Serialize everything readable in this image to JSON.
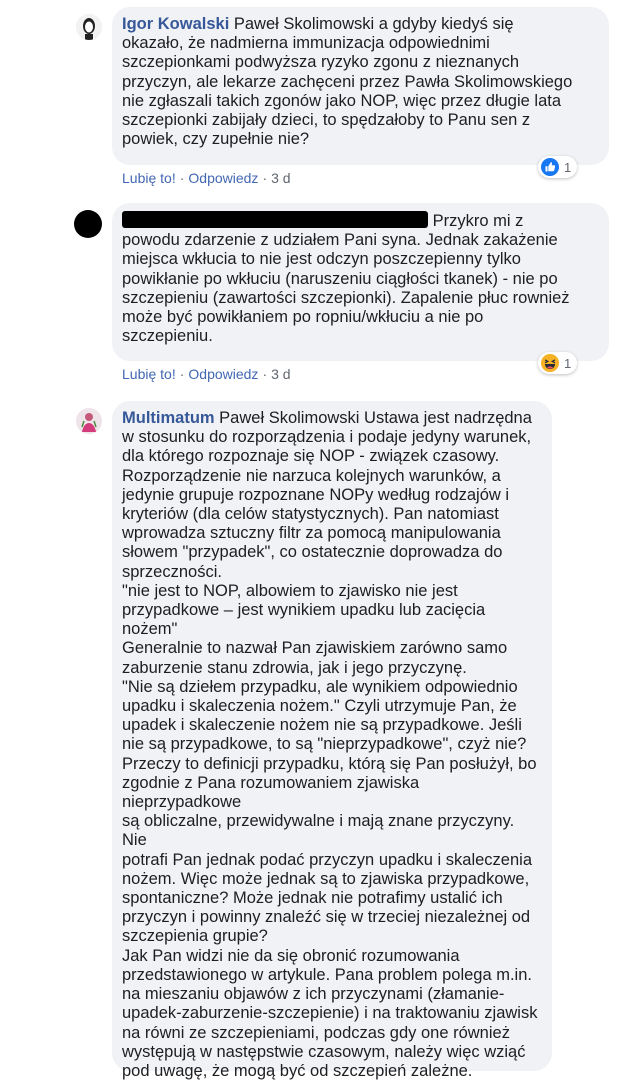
{
  "comments": [
    {
      "author": "Igor Kowalski",
      "text": " Paweł Skolimowski a gdyby kiedyś się\nokazało, że nadmierna immunizacja odpowiednimi\nszczepionkami podwyższa ryzyko zgonu z nieznanych\nprzyczyn, ale lekarze zachęceni przez Pawła Skolimowskiego\nnie zgłaszali takich zgonów jako NOP, więc przez długie lata\nszczepionki zabijały dzieci, to spędzałoby to Panu sen z\npowiek, czy zupełnie nie?",
      "like_label": "Lubię to!",
      "reply_label": "Odpowiedz",
      "time": "3 d",
      "reaction_icon": "like-icon",
      "reaction_count": "1"
    },
    {
      "author": "",
      "text": " Przykro mi z\npowodu zdarzenie z udziałem Pani syna. Jednak zakażenie\nmiejsca wkłucia to nie jest odczyn poszczepienny tylko\npowikłanie po wkłuciu (naruszeniu ciągłości tkanek) - nie po\nszczepieniu (zawartości szczepionki). Zapalenie płuc rownież\nmoże być powikłaniem po ropniu/wkłuciu a nie po\nszczepieniu.",
      "like_label": "Lubię to!",
      "reply_label": "Odpowiedz",
      "time": "3 d",
      "reaction_icon": "haha-icon",
      "reaction_count": "1"
    },
    {
      "author": "Multimatum",
      "text": " Paweł Skolimowski Ustawa jest nadrzędna\nw stosunku do rozporządzenia i podaje jedyny warunek,\ndla którego rozpoznaje się NOP - związek czasowy.\nRozporządzenie nie narzuca kolejnych warunków, a\njedynie grupuje rozpoznane NOPy według rodzajów i\nkryteriów (dla celów statystycznych). Pan natomiast\nwprowadza sztuczny filtr za pomocą manipulowania\nsłowem \"przypadek\", co ostatecznie doprowadza do\nsprzeczności.\n\"nie jest to NOP, albowiem to zjawisko nie jest\nprzypadkowe – jest wynikiem upadku lub zacięcia nożem\"\nGeneralnie to nazwał Pan zjawiskiem zarówno samo\nzaburzenie stanu zdrowia, jak i jego przyczynę.\n\"Nie są dziełem przypadku, ale wynikiem odpowiednio\nupadku i skaleczenia nożem.\" Czyli utrzymuje Pan, że\nupadek i skaleczenie nożem nie są przypadkowe. Jeśli\nnie są przypadkowe, to są \"nieprzypadkowe\", czyż nie?\nPrzeczy to definicji przypadku, którą się Pan posłużył, bo\nzgodnie z Pana rozumowaniem zjawiska nieprzypadkowe\nsą obliczalne, przewidywalne i mają znane przyczyny. Nie\npotrafi Pan jednak podać przyczyn upadku i skaleczenia\nnożem. Więc może jednak są to zjawiska przypadkowe,\nspontaniczne? Może jednak nie potrafimy ustalić ich\nprzyczyn i powinny znaleźć się w trzeciej niezależnej od\nszczepienia grupie?\nJak Pan widzi nie da się obronić rozumowania\nprzedstawionego w artykule. Pana problem polega m.in.\nna mieszaniu objawów z ich przyczynami (złamanie-\nupadek-zaburzenie-szczepienie) i na traktowaniu zjawisk\nna równi ze szczepieniami, podczas gdy one również\nwystępują w następstwie czasowym, należy więc wziąć\npod uwagę, że mogą być od szczepień zależne."
    }
  ],
  "colors": {
    "bubble": "#f0f2f5",
    "author": "#365899",
    "action_link": "#4267b2",
    "meta": "#606770",
    "like_blue": "#1877f2",
    "haha_yellow": "#f7b125"
  }
}
